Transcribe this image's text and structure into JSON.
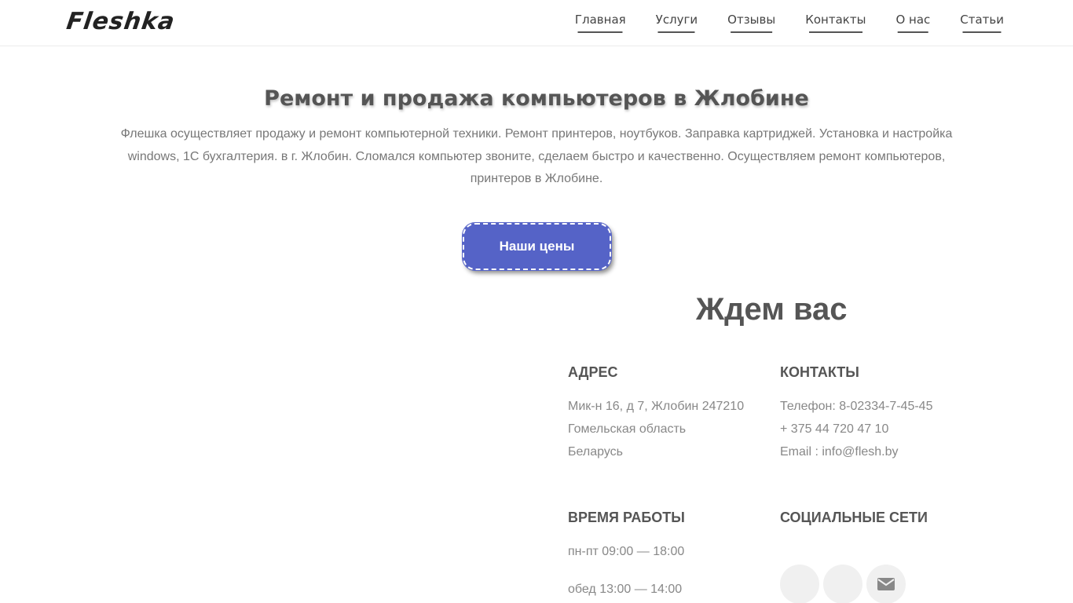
{
  "header": {
    "logo": "Fleshka",
    "nav": [
      "Главная",
      "Услуги",
      "Отзывы",
      "Контакты",
      "О нас",
      "Статьи"
    ]
  },
  "hero": {
    "title": "Ремонт и продажа компьютеров в Жлобине",
    "description": "Флешка осуществляет продажу и ремонт компьютерной техники. Ремонт принтеров, ноутбуков. Заправка картриджей. Установка и настройка windows, 1С бухгалтерия. в г. Жлобин. Сломался компьютер звоните, сделаем быстро и качественно. Осуществляем ремонт компьютеров, принтеров в Жлобине.",
    "button": "Наши цены"
  },
  "contacts_section": {
    "title": "Ждем вас",
    "address": {
      "heading": "АДРЕС",
      "lines": [
        "Мик-н 16, д 7, Жлобин 247210",
        "Гомельская область",
        "Беларусь"
      ]
    },
    "contacts": {
      "heading": "КОНТАКТЫ",
      "lines": [
        "Телефон: 8-02334-7-45-45",
        "+ 375 44 720 47 10",
        "Email : info@flesh.by"
      ]
    },
    "hours": {
      "heading": "ВРЕМЯ РАБОТЫ",
      "lines": [
        "пн-пт 09:00 — 18:00",
        "обед 13:00 — 14:00"
      ]
    },
    "social": {
      "heading": "СОЦИАЛЬНЫЕ СЕТИ",
      "icons": [
        "social-icon",
        "social-icon",
        "envelope-icon"
      ]
    }
  }
}
